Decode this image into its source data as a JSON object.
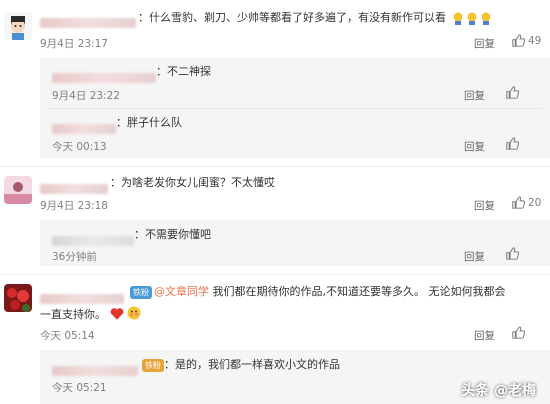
{
  "comments": [
    {
      "text": "：什么雪豹、剃刀、少帅等都看了好多遍了，有没有新作可以看",
      "time": "9月4日 23:17",
      "reply": "回复",
      "likes": "49",
      "replies": [
        {
          "text": "：不二神探",
          "time": "9月4日 23:22",
          "reply": "回复"
        },
        {
          "text": "：胖子什么队",
          "time": "今天 00:13",
          "reply": "回复"
        }
      ]
    },
    {
      "text": "：为啥老发你女儿闺蜜？不太懂哎",
      "time": "9月4日 23:18",
      "reply": "回复",
      "likes": "20",
      "replies": [
        {
          "text": "：不需要你懂吧",
          "time": "36分钟前",
          "reply": "回复"
        }
      ]
    },
    {
      "badge": "铁粉",
      "mention": "@文章同学",
      "text_line1": "我们都在期待你的作品,不知道还要等多久。 无论如何我都会",
      "text_line2": "一直支持你。",
      "time": "今天 05:14",
      "reply": "回复",
      "replies": [
        {
          "badge": "铁粉",
          "text": "：是的，我们都一样喜欢小文的作品",
          "time": "今天 05:21"
        }
      ]
    }
  ],
  "watermark": "头条 @老梅",
  "colors": {
    "link": "#eb7350",
    "sub_bg": "#f5f5f5",
    "meta": "#808080",
    "badge": "#4a9ad8"
  }
}
